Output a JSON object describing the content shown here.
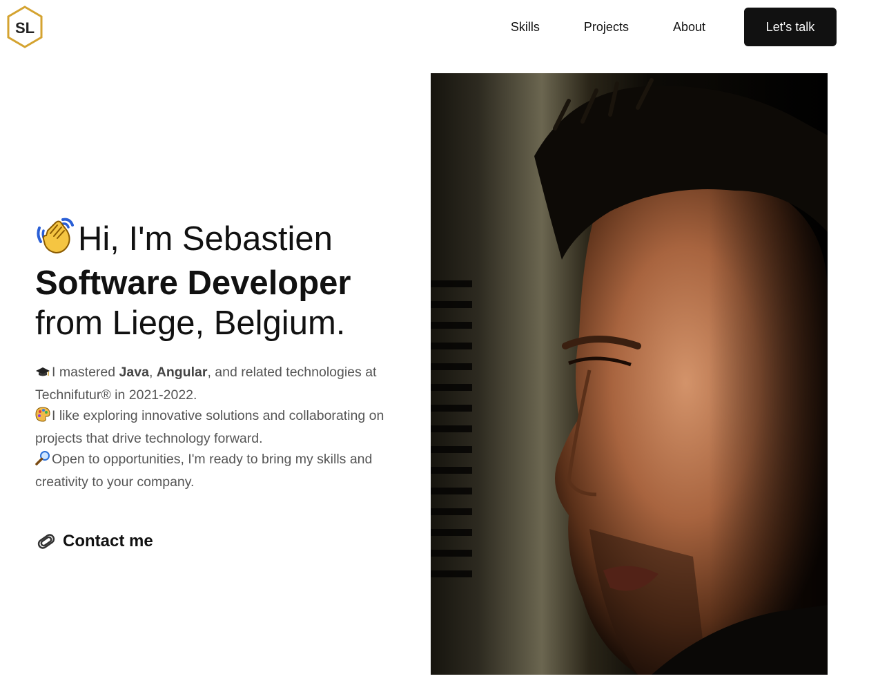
{
  "header": {
    "logo_text": "SL",
    "nav": [
      {
        "label": "Skills"
      },
      {
        "label": "Projects"
      },
      {
        "label": "About"
      }
    ],
    "cta_label": "Let's talk"
  },
  "hero": {
    "greeting": "Hi, I'm Sebastien",
    "role": "Software Developer",
    "location": "from Liege, Belgium.",
    "bio": {
      "line1": {
        "pre": "I mastered ",
        "java": "Java",
        "comma": ", ",
        "angular": "Angular",
        "post": ", and related technologies at Technifutur® in 2021-2022."
      },
      "line2": "I like exploring innovative solutions and collaborating on projects that drive technology forward.",
      "line3": "Open to opportunities, I'm ready to bring my skills and creativity to your company."
    },
    "contact_label": "Contact me"
  },
  "icons": {
    "logo": "hexagon-logo-icon",
    "wave": "waving-hand-icon",
    "grad": "graduation-cap-icon",
    "palette": "palette-icon",
    "magnifier": "magnifying-glass-icon",
    "clip": "paperclip-icon"
  },
  "colors": {
    "logo_gold": "#d4a330",
    "button_bg": "#111111",
    "body_text": "#555555"
  }
}
